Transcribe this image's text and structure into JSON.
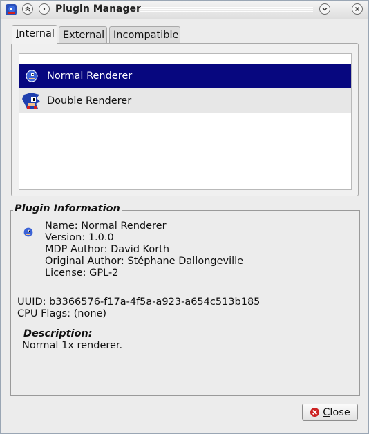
{
  "window": {
    "title": "Plugin Manager"
  },
  "tabs": [
    {
      "label": "Internal",
      "mnemonic": "I",
      "rest": "nternal"
    },
    {
      "label": "External",
      "mnemonic": "E",
      "rest": "xternal"
    },
    {
      "label": "Incompatible",
      "pre": "I",
      "mnemonic": "n",
      "rest": "compatible"
    }
  ],
  "plugins": [
    {
      "name": "Normal Renderer",
      "selected": true
    },
    {
      "name": "Double Renderer",
      "selected": false
    }
  ],
  "info": {
    "group_title": "Plugin Information",
    "name_line": "Name: Normal Renderer",
    "version_line": "Version: 1.0.0",
    "mdp_author_line": "MDP Author: David Korth",
    "original_author_line": "Original Author: Stéphane Dallongeville",
    "license_line": "License: GPL-2",
    "uuid_line": "UUID: b3366576-f17a-4f5a-a923-a654c513b185",
    "cpu_flags_line": "CPU Flags: (none)",
    "description_title": "Description:",
    "description_text": "Normal 1x renderer."
  },
  "buttons": {
    "close_label": "Close",
    "close_mnemonic": "C",
    "close_rest": "lose"
  },
  "colors": {
    "selection": "#07077f",
    "close_icon": "#cc2222"
  }
}
